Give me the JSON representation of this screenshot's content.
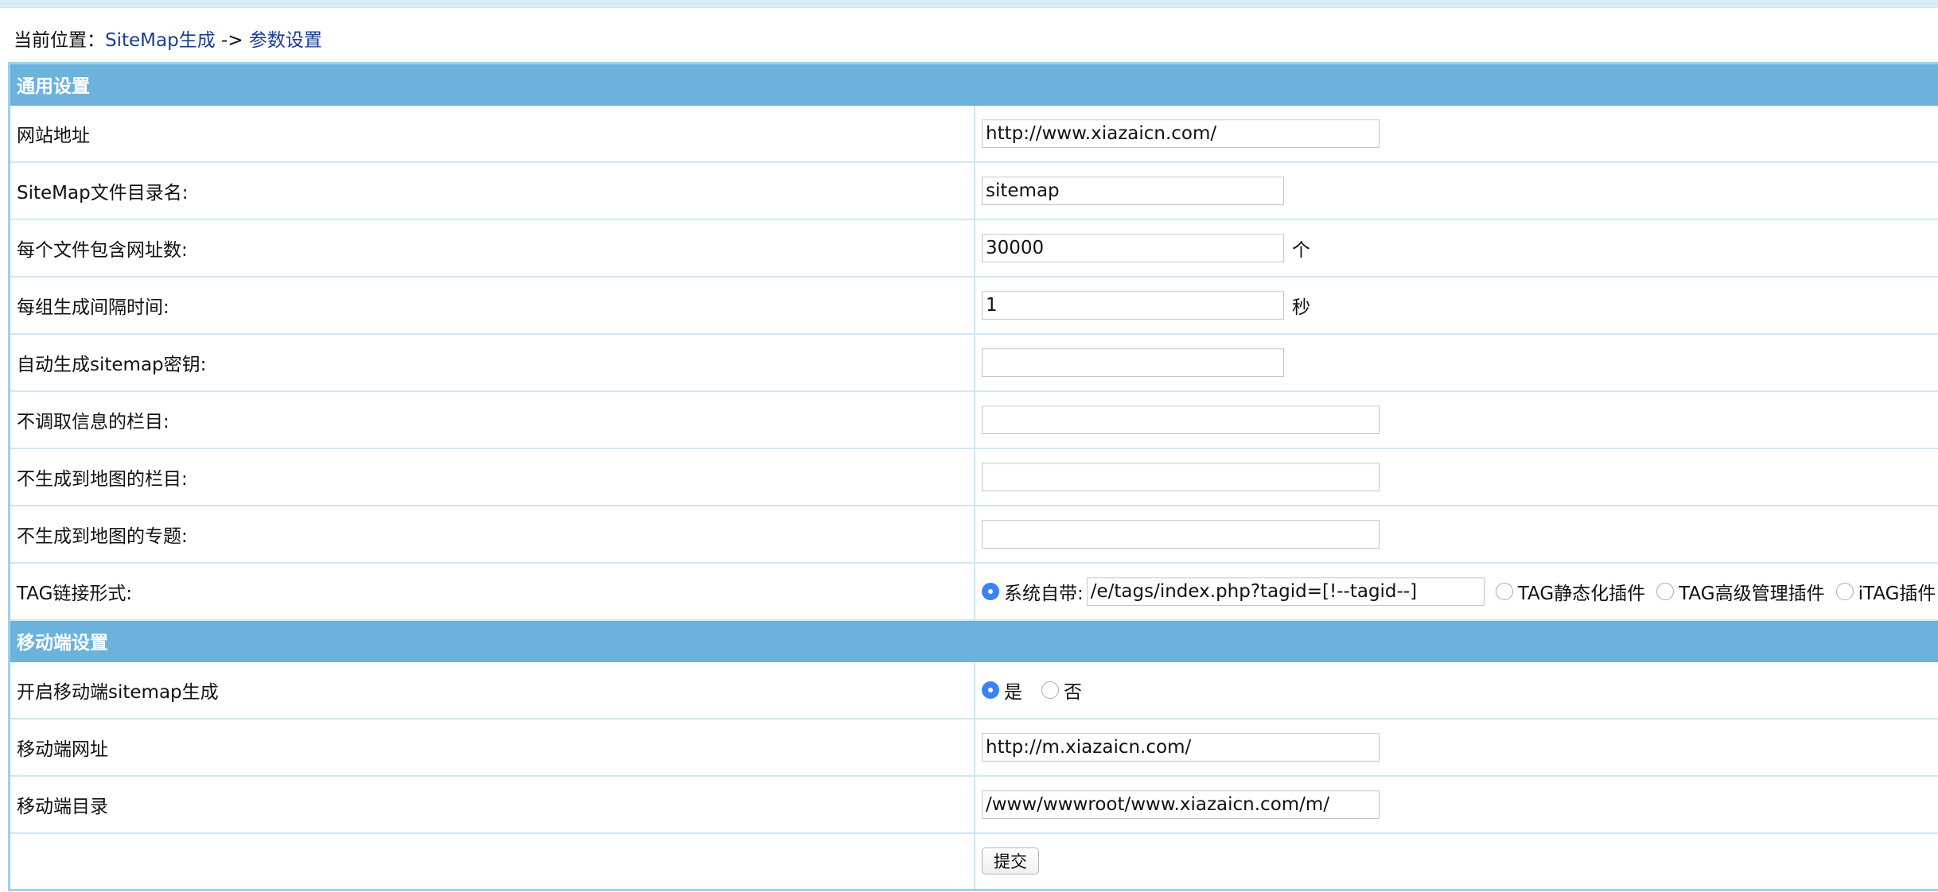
{
  "breadcrumb": {
    "prefix": "当前位置：",
    "link1": "SiteMap生成",
    "separator": " -> ",
    "link2": "参数设置"
  },
  "sections": {
    "general": "通用设置",
    "mobile": "移动端设置"
  },
  "fields": {
    "site_url": {
      "label": "网站地址",
      "value": "http://www.xiazaicn.com/"
    },
    "sitemap_dir": {
      "label": "SiteMap文件目录名:",
      "value": "sitemap"
    },
    "urls_per_file": {
      "label": "每个文件包含网址数:",
      "value": "30000",
      "unit": "个"
    },
    "interval": {
      "label": "每组生成间隔时间:",
      "value": "1",
      "unit": "秒"
    },
    "auto_key": {
      "label": "自动生成sitemap密钥:",
      "value": ""
    },
    "exclude_columns": {
      "label": "不调取信息的栏目:",
      "value": ""
    },
    "no_map_columns": {
      "label": "不生成到地图的栏目:",
      "value": ""
    },
    "no_map_topics": {
      "label": "不生成到地图的专题:",
      "value": ""
    },
    "tag_link": {
      "label": "TAG链接形式:",
      "options": [
        {
          "label": "系统自带:",
          "checked": true
        },
        {
          "label": "TAG静态化插件",
          "checked": false
        },
        {
          "label": "TAG高级管理插件",
          "checked": false
        },
        {
          "label": "iTAG插件",
          "checked": false
        }
      ],
      "system_value": "/e/tags/index.php?tagid=[!--tagid--]"
    },
    "mobile_enable": {
      "label": "开启移动端sitemap生成",
      "options": [
        {
          "label": "是",
          "checked": true
        },
        {
          "label": "否",
          "checked": false
        }
      ]
    },
    "mobile_url": {
      "label": "移动端网址",
      "value": "http://m.xiazaicn.com/"
    },
    "mobile_dir": {
      "label": "移动端目录",
      "value": "/www/wwwroot/www.xiazaicn.com/m/"
    }
  },
  "submit_label": "提交"
}
